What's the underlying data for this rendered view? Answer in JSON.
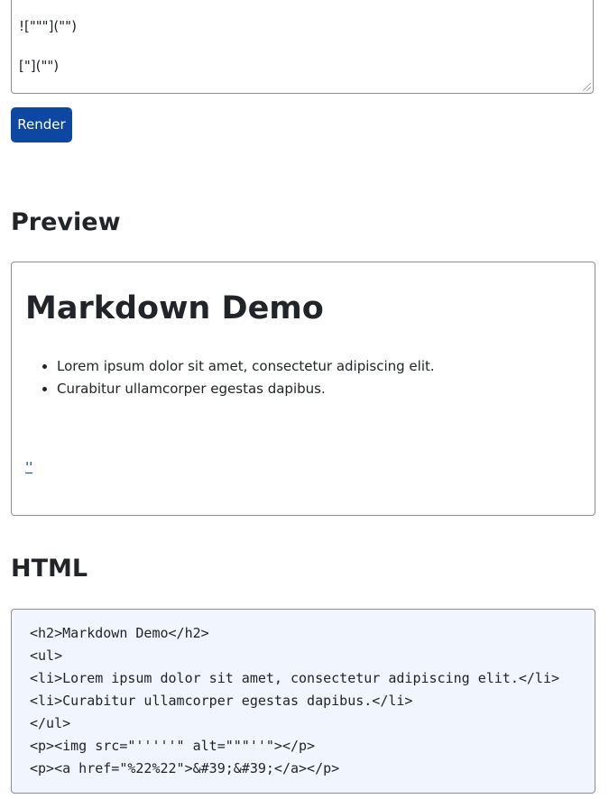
{
  "editor": {
    "lines": [
      "![\"\"\"](\"\")",
      "[\"](\"\")"
    ]
  },
  "render_button": {
    "label": "Render"
  },
  "preview": {
    "heading": "Preview",
    "title": "Markdown Demo",
    "items": [
      "Lorem ipsum dolor sit amet, consectetur adipiscing elit.",
      "Curabitur ullamcorper egestas dapibus."
    ],
    "link_text": "''"
  },
  "html_section": {
    "heading": "HTML",
    "code_lines": [
      "<h2>Markdown Demo</h2>",
      "<ul>",
      "<li>Lorem ipsum dolor sit amet, consectetur adipiscing elit.</li>",
      "<li>Curabitur ullamcorper egestas dapibus.</li>",
      "</ul>",
      "<p><img src=\"'''''\" alt=\"\"\"''\"></p>",
      "<p><a href=\"%22%22\">&#39;&#39;</a></p>"
    ]
  },
  "colors": {
    "button_bg": "#0d47a1",
    "link": "#0d47a1",
    "code_bg": "#f1f5fd",
    "border": "#8e8e8e"
  }
}
